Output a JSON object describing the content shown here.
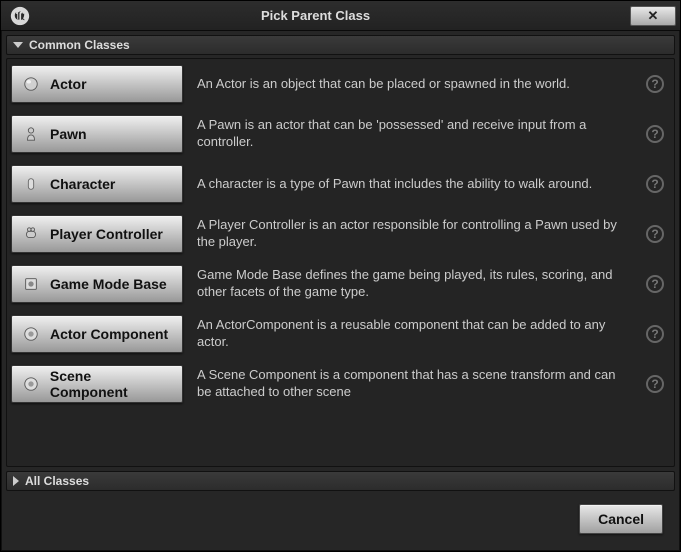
{
  "window": {
    "title": "Pick Parent Class"
  },
  "sections": {
    "common": "Common Classes",
    "all": "All Classes"
  },
  "classes": [
    {
      "name": "Actor",
      "icon": "actor",
      "desc": "An Actor is an object that can be placed or spawned in the world."
    },
    {
      "name": "Pawn",
      "icon": "pawn",
      "desc": "A Pawn is an actor that can be 'possessed' and receive input from a controller."
    },
    {
      "name": "Character",
      "icon": "character",
      "desc": "A character is a type of Pawn that includes the ability to walk around."
    },
    {
      "name": "Player Controller",
      "icon": "player-controller",
      "desc": "A Player Controller is an actor responsible for controlling a Pawn used by the player."
    },
    {
      "name": "Game Mode Base",
      "icon": "game-mode",
      "desc": "Game Mode Base defines the game being played, its rules, scoring, and other facets of the game type."
    },
    {
      "name": "Actor Component",
      "icon": "actor-component",
      "desc": "An ActorComponent is a reusable component that can be added to any actor."
    },
    {
      "name": "Scene Component",
      "icon": "scene-component",
      "desc": "A Scene Component is a component that has a scene transform and can be attached to other scene"
    }
  ],
  "buttons": {
    "cancel": "Cancel",
    "close": "✕"
  }
}
